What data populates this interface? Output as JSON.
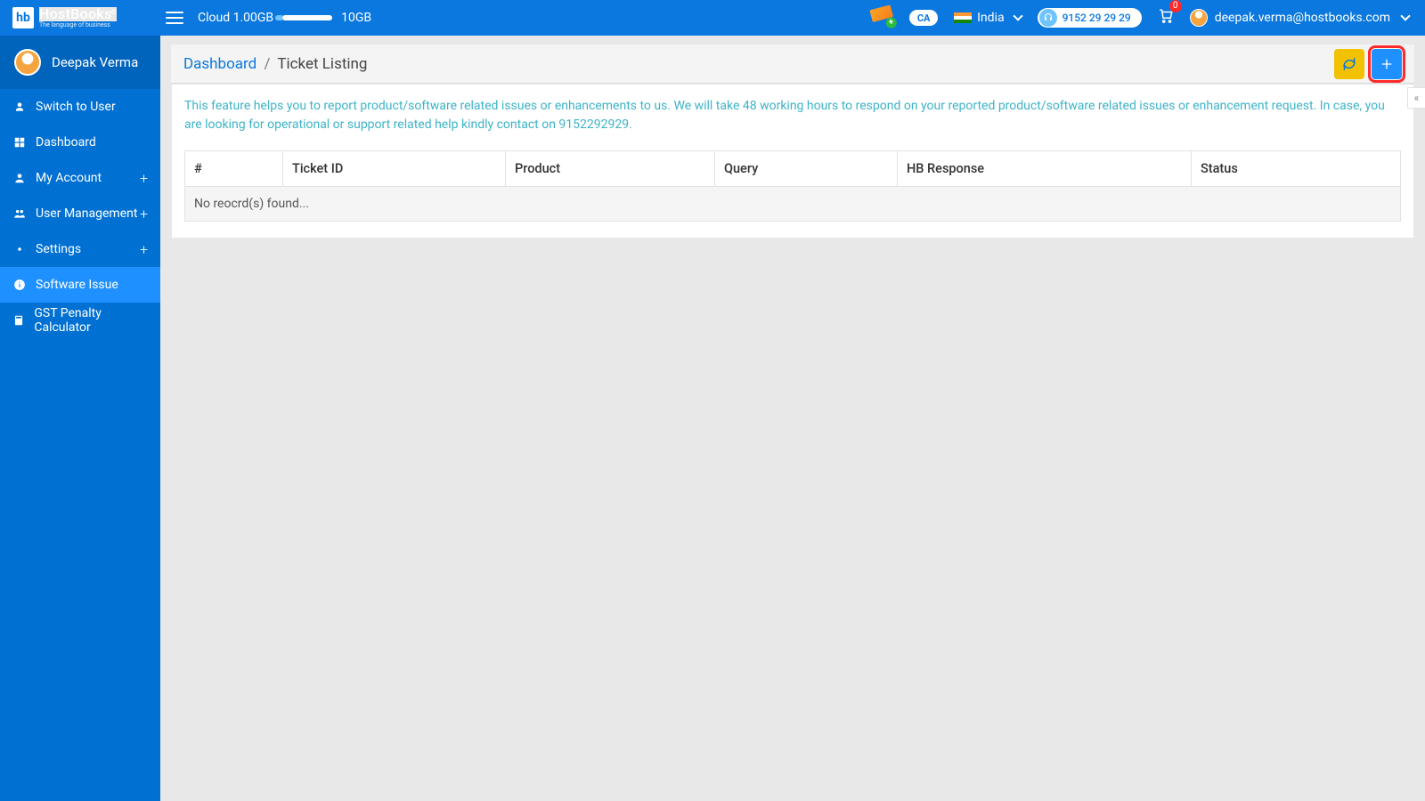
{
  "header": {
    "logo": {
      "mark": "hb",
      "name": "HostBooks",
      "tagline": "The language of business",
      "reg": "®"
    },
    "cloud": {
      "label": "Cloud 1.00GB",
      "total": "10GB"
    },
    "country": {
      "name": "India"
    },
    "phone": "9152 29 29 29",
    "cart_count": "0",
    "user_email": "deepak.verma@hostbooks.com",
    "ca_badge": "CA"
  },
  "sidebar": {
    "user_name": "Deepak Verma",
    "items": [
      {
        "label": "Switch to User",
        "icon": "user",
        "plus": false
      },
      {
        "label": "Dashboard",
        "icon": "dashboard",
        "plus": false
      },
      {
        "label": "My Account",
        "icon": "account",
        "plus": true
      },
      {
        "label": "User Management",
        "icon": "users",
        "plus": true
      },
      {
        "label": "Settings",
        "icon": "gear",
        "plus": true
      },
      {
        "label": "Software Issue",
        "icon": "info",
        "plus": false,
        "active": true
      },
      {
        "label": "GST Penalty Calculator",
        "icon": "calculator",
        "plus": false
      }
    ]
  },
  "breadcrumb": {
    "root": "Dashboard",
    "sep": "/",
    "current": "Ticket Listing"
  },
  "info_text": "This feature helps you to report product/software related issues or enhancements to us. We will take 48 working hours to respond on your reported product/software related issues or enhancement request. In case, you are looking for operational or support related help kindly contact on 9152292929.",
  "table": {
    "headers": [
      "#",
      "Ticket ID",
      "Product",
      "Query",
      "HB Response",
      "Status"
    ],
    "empty_text": "No reocrd(s) found..."
  }
}
